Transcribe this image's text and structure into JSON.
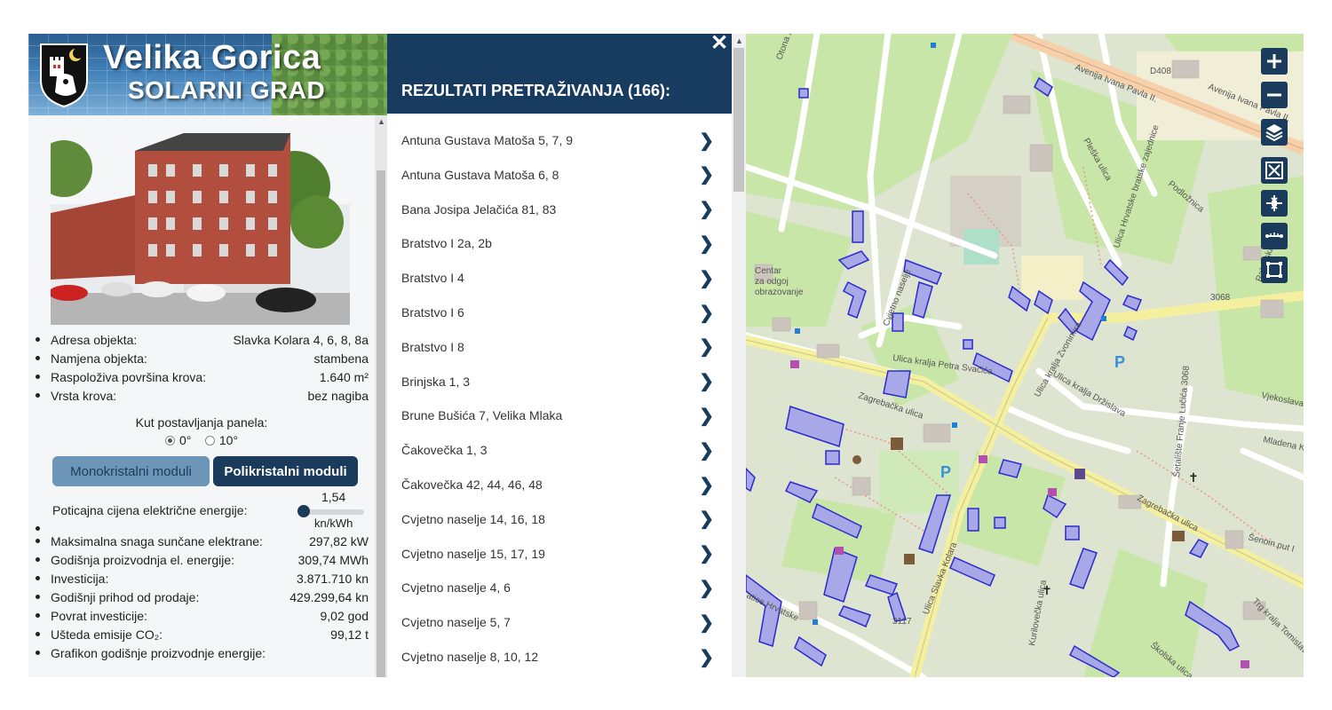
{
  "brand": {
    "title": "Velika Gorica",
    "subtitle": "SOLARNI GRAD"
  },
  "building": {
    "properties": [
      {
        "label": "Adresa objekta:",
        "value": "Slavka Kolara 4, 6, 8, 8a"
      },
      {
        "label": "Namjena objekta:",
        "value": "stambena"
      },
      {
        "label": "Raspoloživa površina krova:",
        "value": "1.640 m²"
      },
      {
        "label": "Vrsta krova:",
        "value": "bez nagiba"
      }
    ],
    "angle_label": "Kut postavljanja panela:",
    "angle_options": [
      "0°",
      "10°"
    ],
    "angle_selected": "0°",
    "module_buttons": {
      "mono": "Monokristalni moduli",
      "poly": "Polikristalni moduli"
    },
    "module_selected": "Polikristalni moduli",
    "price_label": "Poticajna cijena električne energije:",
    "price_value": "1,54",
    "price_unit": "kn/kWh",
    "price_fraction": 0.0,
    "metrics": [
      {
        "label": "Maksimalna snaga sunčane elektrane:",
        "value": "297,82 kW"
      },
      {
        "label": "Godišnja proizvodnja el. energije:",
        "value": "309,74 MWh"
      },
      {
        "label": "Investicija:",
        "value": "3.871.710 kn"
      },
      {
        "label": "Godišnji prihod od prodaje:",
        "value": "429.299,64 kn"
      },
      {
        "label": "Povrat investicije:",
        "value": "9,02 god"
      },
      {
        "label": "Ušteda emisije CO₂:",
        "value": "99,12 t"
      },
      {
        "label": "Grafikon godišnje proizvodnje energije:",
        "value": ""
      }
    ]
  },
  "results": {
    "title": "REZULTATI PRETRAŽIVANJA (166):",
    "items": [
      "Antuna Gustava Matoša 5, 7, 9",
      "Antuna Gustava Matoša 6, 8",
      "Bana Josipa Jelačića 81, 83",
      "Bratstvo I 2a, 2b",
      "Bratstvo I 4",
      "Bratstvo I 6",
      "Bratstvo I 8",
      "Brinjska 1, 3",
      "Brune Bušića 7, Velika Mlaka",
      "Čakovečka 1, 3",
      "Čakovečka 42, 44, 46, 48",
      "Cvjetno naselje 14, 16, 18",
      "Cvjetno naselje 15, 17, 19",
      "Cvjetno naselje 4, 6",
      "Cvjetno naselje 5, 7",
      "Cvjetno naselje 8, 10, 12"
    ],
    "close_symbol": "✕"
  },
  "map": {
    "controls": [
      "zoom-in",
      "zoom-out",
      "layers",
      "fullscreen",
      "zoom-extent",
      "measure-distance",
      "measure-area"
    ],
    "labels": {
      "avenue": "Avenija Ivana Pavla II.",
      "d408": "D408",
      "zagrebacka": "Zagrebačka ulica",
      "zagrebacka2": "Zagrebačka ulica",
      "slavka_kolara": "Ulica Slavka Kolara",
      "kralja_zvonimira": "Ulica kralja Zvonimira",
      "petra_svacica": "Ulica kralja Petra Svačića",
      "drzislava": "Ulica kralja Držislava",
      "trg_tomislava": "Trg kralja Tomislava",
      "skolska": "Školska ulica",
      "road3068": "3068",
      "road3117": "3117",
      "podloznica": "Podložnica",
      "plesko": "Pleška ulica",
      "rakarska": "Rakarska",
      "vjekoslava": "Vjekoslava",
      "mladena": "Mladena K",
      "senoin": "Šenoin put I",
      "centar": "Centar",
      "za_odgoj": "za odgoj",
      "obrazovanje": "obrazovanje",
      "cvjetno": "Cvjetno naselje",
      "hrvatske_bratske": "Ulica Hrvatske bratske zajednice",
      "otona": "Otona Župa",
      "ulica_matice": "atice Hrvatske",
      "kurilovecka": "Kurilovečka ulica",
      "sestaliste": "Šetalište Franje Lučića 3068",
      "parking": "P"
    }
  },
  "colors": {
    "header_navy": "#173c5f",
    "button_navy": "#1a3b5c",
    "button_light": "#6d95b8",
    "building_outline": "#2a2ad0",
    "building_fill": "#a8a8e8"
  }
}
